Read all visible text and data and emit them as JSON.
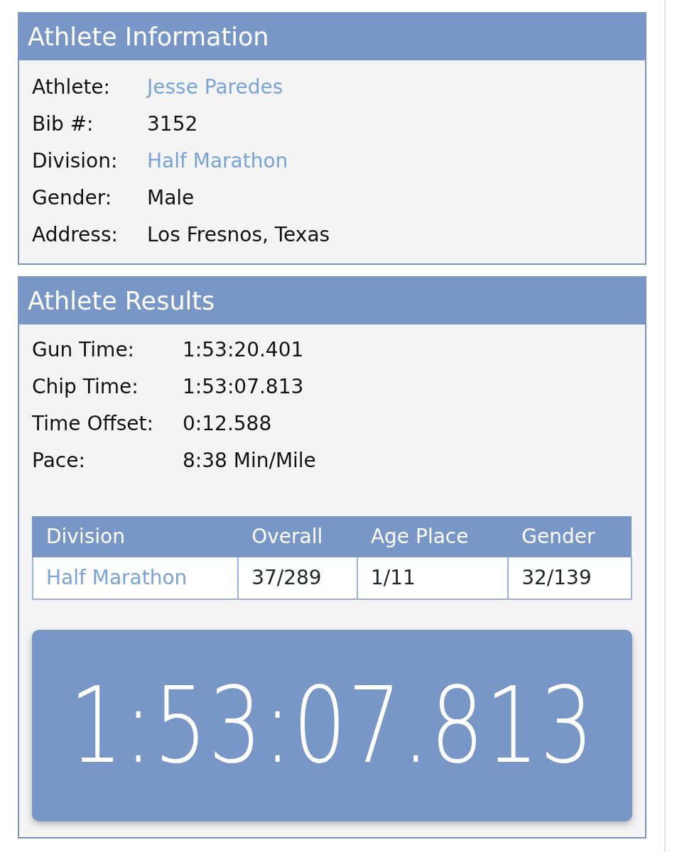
{
  "athlete_information": {
    "title": "Athlete Information",
    "fields": [
      {
        "label": "Athlete:",
        "value": "Jesse Paredes",
        "kind": "link"
      },
      {
        "label": "Bib #:",
        "value": "3152",
        "kind": "text"
      },
      {
        "label": "Division:",
        "value": "Half Marathon",
        "kind": "link"
      },
      {
        "label": "Gender:",
        "value": "Male",
        "kind": "text"
      },
      {
        "label": "Address:",
        "value": "Los Fresnos, Texas",
        "kind": "text"
      }
    ]
  },
  "athlete_results": {
    "title": "Athlete Results",
    "fields": [
      {
        "label": "Gun Time:",
        "value": "1:53:20.401"
      },
      {
        "label": "Chip Time:",
        "value": "1:53:07.813"
      },
      {
        "label": "Time Offset:",
        "value": "0:12.588"
      },
      {
        "label": "Pace:",
        "value": "8:38 Min/Mile"
      }
    ],
    "table": {
      "columns": [
        "Division",
        "Overall",
        "Age Place",
        "Gender"
      ],
      "rows": [
        [
          {
            "text": "Half Marathon",
            "kind": "link"
          },
          {
            "text": "37/289",
            "kind": "text"
          },
          {
            "text": "1/11",
            "kind": "text"
          },
          {
            "text": "32/139",
            "kind": "text"
          }
        ]
      ]
    },
    "clock": "1:53:07.813"
  }
}
